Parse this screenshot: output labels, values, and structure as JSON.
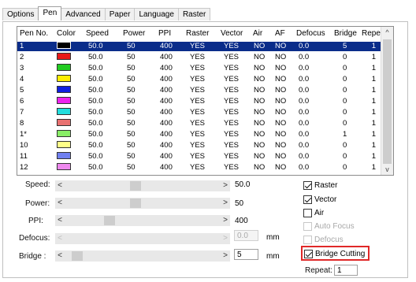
{
  "tabs": [
    "Options",
    "Pen",
    "Advanced",
    "Paper",
    "Language",
    "Raster"
  ],
  "active_tab": "Pen",
  "table": {
    "columns": [
      "Pen No.",
      "Color",
      "Speed",
      "Power",
      "PPI",
      "Raster",
      "Vector",
      "Air",
      "AF",
      "Defocus",
      "Bridge",
      "Repeat"
    ],
    "rows": [
      {
        "pen": "1",
        "color": "#000000",
        "speed": "50.0",
        "power": "50",
        "ppi": "400",
        "raster": "YES",
        "vector": "YES",
        "air": "NO",
        "af": "NO",
        "defocus": "0.0",
        "bridge": "5",
        "repeat": "1"
      },
      {
        "pen": "2",
        "color": "#e81818",
        "speed": "50.0",
        "power": "50",
        "ppi": "400",
        "raster": "YES",
        "vector": "YES",
        "air": "NO",
        "af": "NO",
        "defocus": "0.0",
        "bridge": "0",
        "repeat": "1"
      },
      {
        "pen": "3",
        "color": "#22cc22",
        "speed": "50.0",
        "power": "50",
        "ppi": "400",
        "raster": "YES",
        "vector": "YES",
        "air": "NO",
        "af": "NO",
        "defocus": "0.0",
        "bridge": "0",
        "repeat": "1"
      },
      {
        "pen": "4",
        "color": "#ffee00",
        "speed": "50.0",
        "power": "50",
        "ppi": "400",
        "raster": "YES",
        "vector": "YES",
        "air": "NO",
        "af": "NO",
        "defocus": "0.0",
        "bridge": "0",
        "repeat": "1"
      },
      {
        "pen": "5",
        "color": "#1020e0",
        "speed": "50.0",
        "power": "50",
        "ppi": "400",
        "raster": "YES",
        "vector": "YES",
        "air": "NO",
        "af": "NO",
        "defocus": "0.0",
        "bridge": "0",
        "repeat": "1"
      },
      {
        "pen": "6",
        "color": "#ee22ee",
        "speed": "50.0",
        "power": "50",
        "ppi": "400",
        "raster": "YES",
        "vector": "YES",
        "air": "NO",
        "af": "NO",
        "defocus": "0.0",
        "bridge": "0",
        "repeat": "1"
      },
      {
        "pen": "7",
        "color": "#22dddd",
        "speed": "50.0",
        "power": "50",
        "ppi": "400",
        "raster": "YES",
        "vector": "YES",
        "air": "NO",
        "af": "NO",
        "defocus": "0.0",
        "bridge": "0",
        "repeat": "1"
      },
      {
        "pen": "8",
        "color": "#e87070",
        "speed": "50.0",
        "power": "50",
        "ppi": "400",
        "raster": "YES",
        "vector": "YES",
        "air": "NO",
        "af": "NO",
        "defocus": "0.0",
        "bridge": "0",
        "repeat": "1"
      },
      {
        "pen": "1*",
        "color": "#88ee66",
        "speed": "50.0",
        "power": "50",
        "ppi": "400",
        "raster": "YES",
        "vector": "YES",
        "air": "NO",
        "af": "NO",
        "defocus": "0.0",
        "bridge": "1",
        "repeat": "1"
      },
      {
        "pen": "10",
        "color": "#ffff88",
        "speed": "50.0",
        "power": "50",
        "ppi": "400",
        "raster": "YES",
        "vector": "YES",
        "air": "NO",
        "af": "NO",
        "defocus": "0.0",
        "bridge": "0",
        "repeat": "1"
      },
      {
        "pen": "11",
        "color": "#7080f0",
        "speed": "50.0",
        "power": "50",
        "ppi": "400",
        "raster": "YES",
        "vector": "YES",
        "air": "NO",
        "af": "NO",
        "defocus": "0.0",
        "bridge": "0",
        "repeat": "1"
      },
      {
        "pen": "12",
        "color": "#ee88ee",
        "speed": "50.0",
        "power": "50",
        "ppi": "400",
        "raster": "YES",
        "vector": "YES",
        "air": "NO",
        "af": "NO",
        "defocus": "0.0",
        "bridge": "0",
        "repeat": "1"
      }
    ],
    "selected_index": 0
  },
  "controls": {
    "speed": {
      "label": "Speed:",
      "value": "50.0",
      "level": 0.45
    },
    "power": {
      "label": "Power:",
      "value": "50",
      "level": 0.45
    },
    "ppi": {
      "label": "PPI:",
      "value": "400",
      "level": 0.27
    },
    "defocus": {
      "label": "Defocus:",
      "value": "0.0",
      "unit": "mm",
      "level": 0
    },
    "bridge": {
      "label": "Bridge :",
      "value": "5",
      "unit": "mm",
      "level": 0.05
    }
  },
  "arrows": {
    "left": "<",
    "right": ">"
  },
  "checkboxes": {
    "raster": {
      "label": "Raster",
      "checked": true
    },
    "vector": {
      "label": "Vector",
      "checked": true
    },
    "air": {
      "label": "Air",
      "checked": false
    },
    "auto_focus": {
      "label": "Auto Focus",
      "checked": false
    },
    "defocus": {
      "label": "Defocus",
      "checked": false
    },
    "bridge_cutting": {
      "label": "Bridge Cutting",
      "checked": true
    }
  },
  "repeat": {
    "label": "Repeat:",
    "value": "1"
  },
  "scroll": {
    "up": "^",
    "down": "v"
  },
  "colors": {
    "selection": "#0a2c8a",
    "highlight_border": "#e02828"
  }
}
